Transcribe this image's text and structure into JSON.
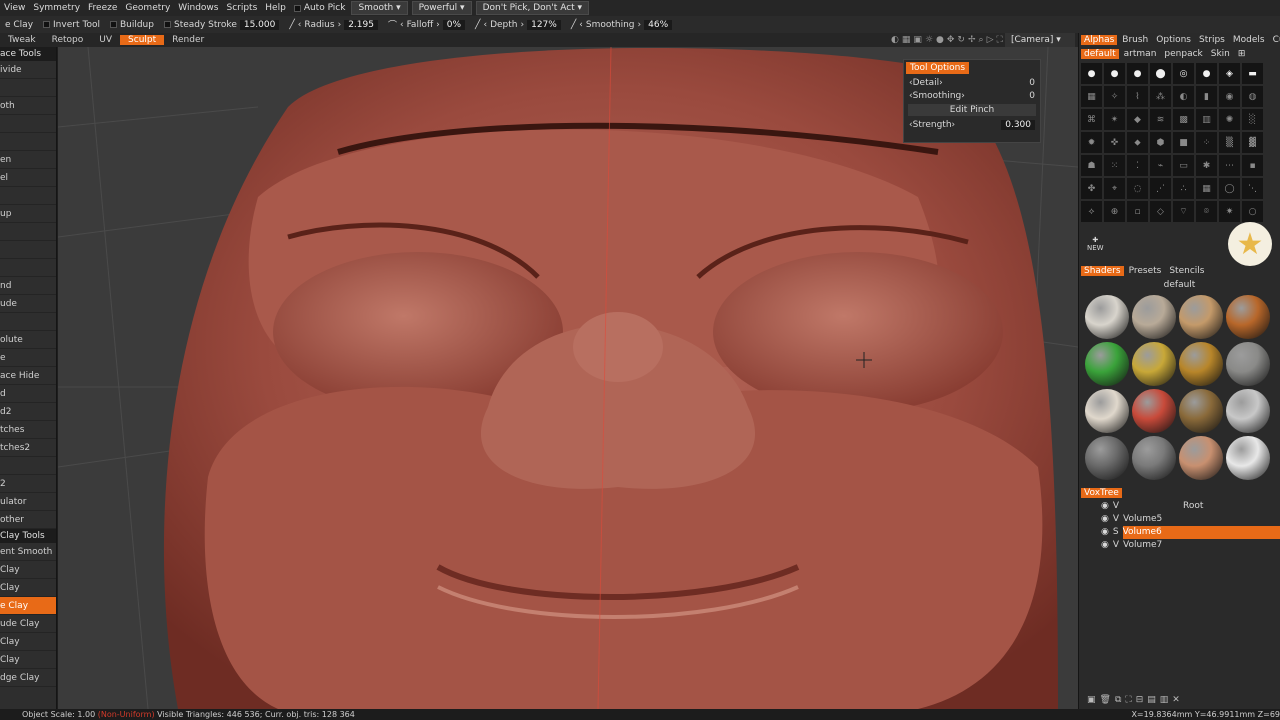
{
  "menubar": {
    "items": [
      "View",
      "Symmetry",
      "Freeze",
      "Geometry",
      "Windows",
      "Scripts",
      "Help"
    ],
    "auto_pick": "Auto Pick",
    "smooth": "Smooth",
    "powerful": "Powerful",
    "dont_pick": "Don't Pick, Don't Act"
  },
  "optbar": {
    "tool": "e Clay",
    "invert": "Invert",
    "tool_label": "Tool",
    "buildup": "Buildup",
    "steady": "Steady Stroke",
    "steady_val": "15.000",
    "radius": "Radius",
    "radius_val": "2.195",
    "falloff": "Falloff",
    "falloff_val": "0%",
    "depth": "Depth",
    "depth_val": "127%",
    "smoothing": "Smoothing",
    "smoothing_val": "46%"
  },
  "modebar": {
    "tabs": [
      "Tweak",
      "Retopo",
      "UV",
      "Sculpt",
      "Render"
    ],
    "active": "Sculpt",
    "camera": "[Camera]"
  },
  "leftpanel": {
    "header": "ace  Tools",
    "items": [
      "ivide",
      "",
      "oth",
      "",
      "",
      "en",
      "el",
      "",
      "up",
      "",
      "",
      "",
      "nd",
      "ude",
      "",
      "olute",
      "e",
      "ace  Hide",
      "d",
      "d2",
      "tches",
      "tches2",
      "",
      "2",
      "ulator",
      "other"
    ],
    "header2": "Clay  Tools",
    "tools": [
      "ent  Smooth",
      "Clay",
      "Clay",
      "e  Clay",
      "ude  Clay",
      "Clay",
      "Clay",
      "dge  Clay"
    ],
    "active_tool": "e  Clay"
  },
  "tool_options": {
    "title": "Tool Options",
    "detail": "Detail",
    "detail_val": "0",
    "smoothing": "Smoothing",
    "smoothing_val": "0",
    "edit_pinch": "Edit Pinch",
    "strength": "Strength",
    "strength_val": "0.300"
  },
  "rightpanel": {
    "tabs": [
      "Alphas",
      "Brush",
      "Options",
      "Strips",
      "Models",
      "Curve"
    ],
    "subtabs": [
      "default",
      "artman",
      "penpack",
      "Skin"
    ],
    "new_label": "NEW",
    "shader_tabs": [
      "Shaders",
      "Presets",
      "Stencils"
    ],
    "shader_default": "default"
  },
  "voxtree": {
    "title": "VoxTree",
    "root": "Root",
    "items": [
      "Volume5",
      "Volume6",
      "Volume7"
    ],
    "active": "Volume6"
  },
  "status": {
    "scale": "Object Scale: 1.00",
    "nonuniform": "(Non-Uniform)",
    "stats": "Visible Triangles: 446 536; Curr. obj. tris: 128 364"
  },
  "coords": "X=19.8364mm  Y=46.9911mm  Z=69"
}
